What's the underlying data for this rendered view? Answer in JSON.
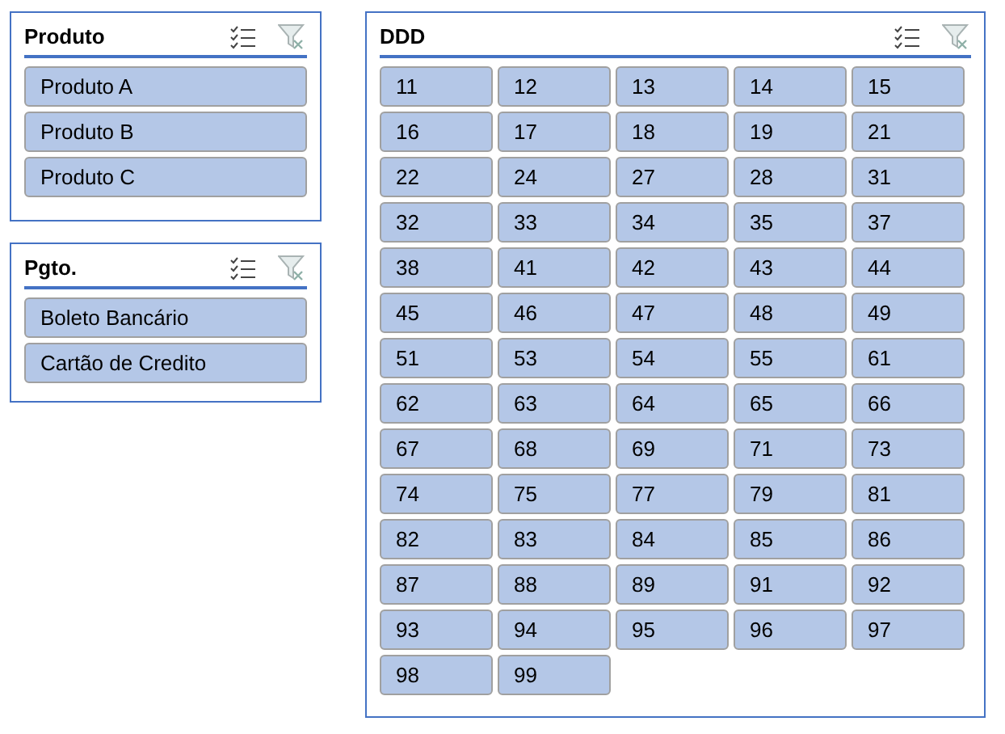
{
  "slicers": [
    {
      "title": "Produto",
      "items": [
        {
          "label": "Produto A",
          "selected": true
        },
        {
          "label": "Produto B",
          "selected": true
        },
        {
          "label": "Produto C",
          "selected": true
        }
      ]
    },
    {
      "title": "Pgto.",
      "items": [
        {
          "label": "Boleto Bancário",
          "selected": true
        },
        {
          "label": "Cartão de Credito",
          "selected": true
        }
      ]
    },
    {
      "title": "DDD",
      "items": [
        {
          "label": "11",
          "selected": true
        },
        {
          "label": "12",
          "selected": true
        },
        {
          "label": "13",
          "selected": true
        },
        {
          "label": "14",
          "selected": true
        },
        {
          "label": "15",
          "selected": true
        },
        {
          "label": "16",
          "selected": true
        },
        {
          "label": "17",
          "selected": true
        },
        {
          "label": "18",
          "selected": true
        },
        {
          "label": "19",
          "selected": true
        },
        {
          "label": "21",
          "selected": true
        },
        {
          "label": "22",
          "selected": true
        },
        {
          "label": "24",
          "selected": true
        },
        {
          "label": "27",
          "selected": true
        },
        {
          "label": "28",
          "selected": true
        },
        {
          "label": "31",
          "selected": true
        },
        {
          "label": "32",
          "selected": true
        },
        {
          "label": "33",
          "selected": true
        },
        {
          "label": "34",
          "selected": true
        },
        {
          "label": "35",
          "selected": true
        },
        {
          "label": "37",
          "selected": true
        },
        {
          "label": "38",
          "selected": true
        },
        {
          "label": "41",
          "selected": true
        },
        {
          "label": "42",
          "selected": true
        },
        {
          "label": "43",
          "selected": true
        },
        {
          "label": "44",
          "selected": true
        },
        {
          "label": "45",
          "selected": true
        },
        {
          "label": "46",
          "selected": true
        },
        {
          "label": "47",
          "selected": true
        },
        {
          "label": "48",
          "selected": true
        },
        {
          "label": "49",
          "selected": true
        },
        {
          "label": "51",
          "selected": true
        },
        {
          "label": "53",
          "selected": true
        },
        {
          "label": "54",
          "selected": true
        },
        {
          "label": "55",
          "selected": true
        },
        {
          "label": "61",
          "selected": true
        },
        {
          "label": "62",
          "selected": true
        },
        {
          "label": "63",
          "selected": true
        },
        {
          "label": "64",
          "selected": true
        },
        {
          "label": "65",
          "selected": true
        },
        {
          "label": "66",
          "selected": true
        },
        {
          "label": "67",
          "selected": true
        },
        {
          "label": "68",
          "selected": true
        },
        {
          "label": "69",
          "selected": true
        },
        {
          "label": "71",
          "selected": true
        },
        {
          "label": "73",
          "selected": true
        },
        {
          "label": "74",
          "selected": true
        },
        {
          "label": "75",
          "selected": true
        },
        {
          "label": "77",
          "selected": true
        },
        {
          "label": "79",
          "selected": true
        },
        {
          "label": "81",
          "selected": true
        },
        {
          "label": "82",
          "selected": true
        },
        {
          "label": "83",
          "selected": true
        },
        {
          "label": "84",
          "selected": true
        },
        {
          "label": "85",
          "selected": true
        },
        {
          "label": "86",
          "selected": true
        },
        {
          "label": "87",
          "selected": true
        },
        {
          "label": "88",
          "selected": true
        },
        {
          "label": "89",
          "selected": true
        },
        {
          "label": "91",
          "selected": true
        },
        {
          "label": "92",
          "selected": true
        },
        {
          "label": "93",
          "selected": true
        },
        {
          "label": "94",
          "selected": true
        },
        {
          "label": "95",
          "selected": true
        },
        {
          "label": "96",
          "selected": true
        },
        {
          "label": "97",
          "selected": true
        },
        {
          "label": "98",
          "selected": true
        },
        {
          "label": "99",
          "selected": true
        }
      ]
    }
  ]
}
